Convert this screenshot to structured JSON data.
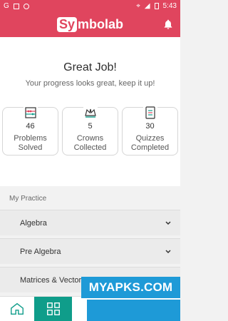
{
  "status": {
    "time": "5:43",
    "left_icons": [
      "g-icon",
      "sim-icon",
      "record-icon"
    ],
    "right_icons": [
      "location-icon",
      "wifi-icon",
      "battery-icon"
    ]
  },
  "app": {
    "logo_prefix": "Sy",
    "logo_suffix": "mbolab"
  },
  "summary": {
    "title": "Great Job!",
    "subtitle": "Your progress looks great, keep it up!",
    "cards": [
      {
        "count": "46",
        "label": "Problems Solved",
        "icon": "abacus-icon"
      },
      {
        "count": "5",
        "label": "Crowns Collected",
        "icon": "crown-icon"
      },
      {
        "count": "30",
        "label": "Quizzes Completed",
        "icon": "quiz-icon"
      }
    ]
  },
  "practice": {
    "header": "My Practice",
    "items": [
      "Algebra",
      "Pre Algebra",
      "Matrices & Vectors"
    ]
  },
  "overlay": {
    "watermark": "MYAPKS.COM"
  },
  "colors": {
    "brand": "#e0455e",
    "nav_active": "#0f9d8a",
    "watermark": "#1e9ad7"
  }
}
